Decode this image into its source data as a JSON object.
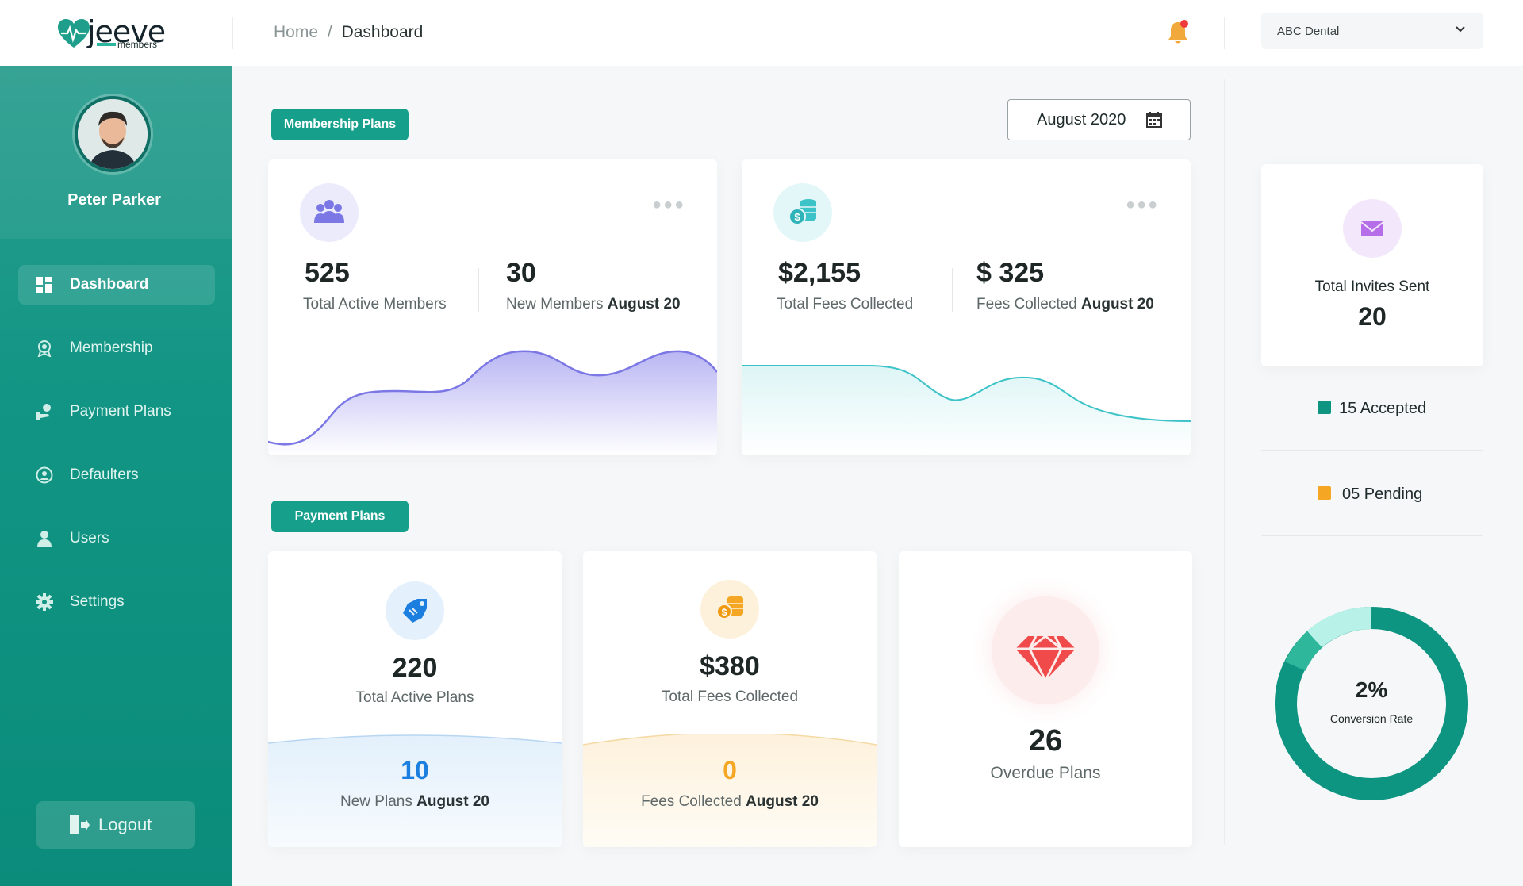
{
  "app": {
    "logo_text": "jeeve",
    "logo_sub": "members"
  },
  "header": {
    "breadcrumb_home": "Home",
    "breadcrumb_sep": "/",
    "breadcrumb_current": "Dashboard",
    "clinic": "ABC Dental",
    "notification_dot_color": "#ee3b3b"
  },
  "profile": {
    "name": "Peter Parker"
  },
  "sidebar": {
    "items": [
      {
        "label": "Dashboard",
        "icon": "grid-icon"
      },
      {
        "label": "Membership",
        "icon": "membership-icon"
      },
      {
        "label": "Payment Plans",
        "icon": "payment-plans-icon"
      },
      {
        "label": "Defaulters",
        "icon": "defaulter-icon"
      },
      {
        "label": "Users",
        "icon": "user-icon"
      },
      {
        "label": "Settings",
        "icon": "gear-icon"
      }
    ],
    "logout": "Logout"
  },
  "membership": {
    "section_label": "Membership Plans",
    "date": "August 2020",
    "members": {
      "total": "525",
      "total_label": "Total Active Members",
      "new": "30",
      "new_label": "New Members",
      "new_month": "August 20"
    },
    "fees": {
      "total": "$2,155",
      "total_label": "Total Fees Collected",
      "month": "$ 325",
      "month_label": "Fees Collected",
      "month_period": "August 20"
    }
  },
  "payment": {
    "section_label": "Payment Plans",
    "plans": {
      "total": "220",
      "total_label": "Total Active Plans",
      "new": "10",
      "new_label": "New Plans",
      "new_month": "August 20"
    },
    "fees": {
      "total": "$380",
      "total_label": "Total Fees Collected",
      "month": "0",
      "month_label": "Fees Collected",
      "month_period": "August 20"
    },
    "overdue": {
      "value": "26",
      "label": "Overdue Plans"
    }
  },
  "invites": {
    "label": "Total Invites Sent",
    "value": "20",
    "accepted": "15 Accepted",
    "pending": "05 Pending",
    "conversion": "2%",
    "conversion_label": "Conversion Rate"
  },
  "colors": {
    "accent": "#16a08c",
    "purple": "#8a86f0",
    "teal": "#3cc3c8",
    "orange": "#f5a623",
    "blue": "#1c7fe0",
    "red": "#f04a4a"
  }
}
